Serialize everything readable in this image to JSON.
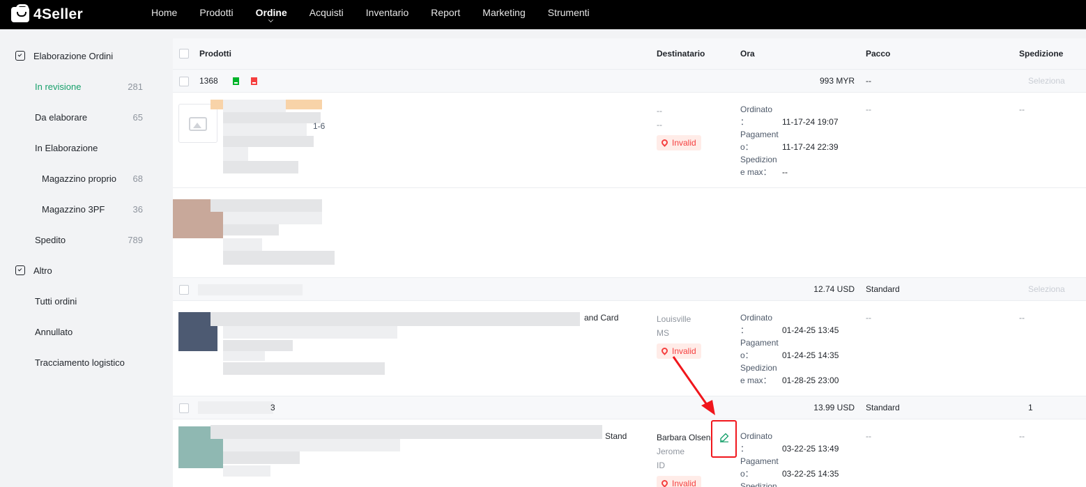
{
  "app": {
    "brand": "4Seller"
  },
  "nav": [
    {
      "label": "Home",
      "active": false
    },
    {
      "label": "Prodotti",
      "active": false
    },
    {
      "label": "Ordine",
      "active": true
    },
    {
      "label": "Acquisti",
      "active": false
    },
    {
      "label": "Inventario",
      "active": false
    },
    {
      "label": "Report",
      "active": false
    },
    {
      "label": "Marketing",
      "active": false
    },
    {
      "label": "Strumenti",
      "active": false
    }
  ],
  "sidebar": {
    "group1": "Elaborazione Ordini",
    "items": [
      {
        "label": "In revisione",
        "count": "281"
      },
      {
        "label": "Da elaborare",
        "count": "65"
      },
      {
        "label": "In Elaborazione",
        "count": ""
      },
      {
        "label": "Magazzino proprio",
        "count": "68"
      },
      {
        "label": "Magazzino 3PF",
        "count": "36"
      },
      {
        "label": "Spedito",
        "count": "789"
      }
    ],
    "group2": "Altro",
    "items2": [
      {
        "label": "Tutti ordini"
      },
      {
        "label": "Annullato"
      },
      {
        "label": "Tracciamento logistico"
      }
    ]
  },
  "table": {
    "headers": {
      "products": "Prodotti",
      "recipient": "Destinatario",
      "time": "Ora",
      "package": "Pacco",
      "shipping": "Spedizione"
    }
  },
  "labels": {
    "ordered_k1": "Ordinato",
    "ordered_k2": "：",
    "paid_k1": "Pagament",
    "paid_k2": "o：",
    "ship_k1": "Spedizion",
    "ship_k2": "e max：",
    "invalid": "Invalid",
    "select": "Seleziona",
    "dash": "--"
  },
  "orders": [
    {
      "id": "1368",
      "total": "993 MYR",
      "package": "--",
      "product_suffix": "1-6",
      "recipient_line1": "--",
      "recipient_line2": "--",
      "ordered": "11-17-24 19:07",
      "paid": "11-17-24 22:39",
      "ship_max": "--",
      "pkg_cell": "--",
      "ship_cell": "--"
    },
    {
      "total": "12.74 USD",
      "package": "Standard",
      "product_suffix": "and Card",
      "recipient_line1": "Louisville",
      "recipient_line2": "MS",
      "ordered": "01-24-25 13:45",
      "paid": "01-24-25 14:35",
      "ship_max": "01-28-25 23:00",
      "pkg_cell": "--",
      "ship_cell": "--"
    },
    {
      "id_suffix": "3",
      "total": "13.99 USD",
      "package": "Standard",
      "shipping_count": "1",
      "product_suffix": "Stand",
      "recipient_line1": "Barbara Olsen",
      "recipient_line2": "Jerome",
      "recipient_line3": "ID",
      "ordered": "03-22-25 13:49",
      "paid": "03-22-25 14:35",
      "pkg_cell": "--",
      "ship_cell": "--"
    }
  ],
  "colors": {
    "accent": "#17a06b",
    "danger": "#f53f3f",
    "annotation": "#f0161c"
  }
}
